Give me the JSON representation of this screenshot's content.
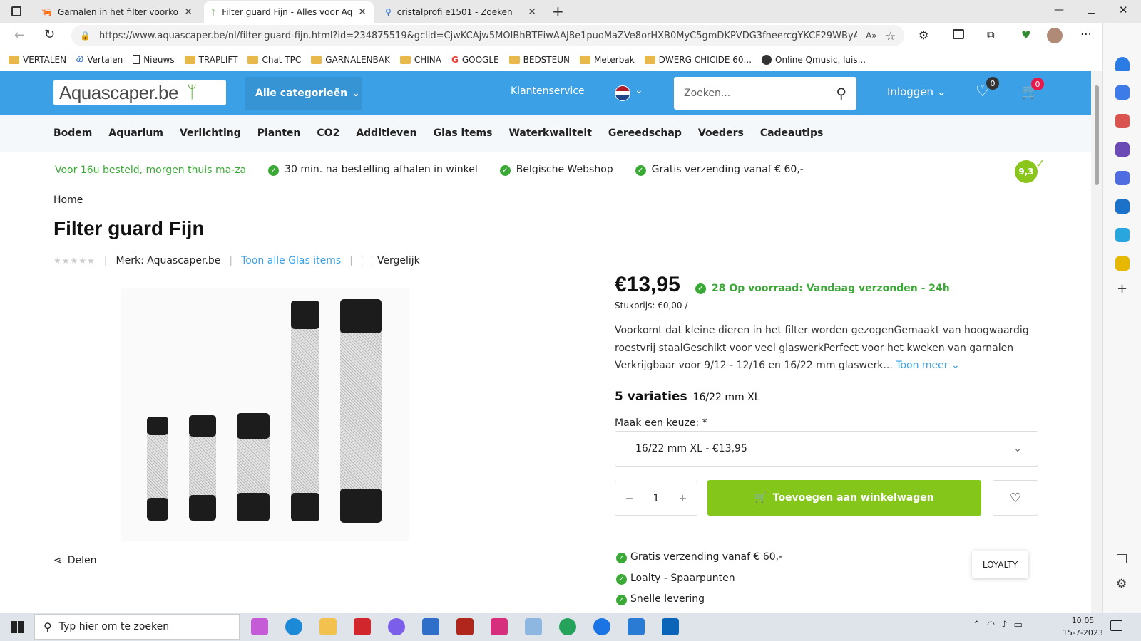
{
  "browser": {
    "tabs": [
      {
        "title": "Garnalen in het filter voorkomen",
        "active": false
      },
      {
        "title": "Filter guard Fijn - Alles voor Aqu",
        "active": true
      },
      {
        "title": "cristalprofi e1501 - Zoeken",
        "active": false
      }
    ],
    "url": "https://www.aquascaper.be/nl/filter-guard-fijn.html?id=234875519&gclid=CjwKCAjw5MOIBhBTEiwAAJ8e1puoMaZVe8orHXB0MyC5gmDKPVDG3fheercgYKCF29WByA...",
    "bookmarks": [
      "VERTALEN",
      "Vertalen",
      "Nieuws",
      "TRAPLIFT",
      "Chat TPC",
      "GARNALENBAK",
      "CHINA",
      "GOOGLE",
      "BEDSTEUN",
      "Meterbak",
      "DWERG CHICIDE 60...",
      "Online Qmusic, luis..."
    ]
  },
  "header": {
    "logo_text": "Aquascaper.be",
    "categories_label": "Alle categorieën",
    "service_label": "Klantenservice",
    "search_placeholder": "Zoeken...",
    "login_label": "Inloggen",
    "wishlist_count": "0",
    "cart_count": "0"
  },
  "catnav": [
    "Bodem",
    "Aquarium",
    "Verlichting",
    "Planten",
    "CO2",
    "Additieven",
    "Glas items",
    "Waterkwaliteit",
    "Gereedschap",
    "Voeders",
    "Cadeautips"
  ],
  "usps": {
    "delivery": "Voor 16u besteld, morgen thuis ma-za",
    "items": [
      "30 min. na bestelling afhalen in winkel",
      "Belgische Webshop",
      "Gratis verzending vanaf € 60,-"
    ],
    "score": "9,3"
  },
  "breadcrumb": "Home",
  "product": {
    "title": "Filter guard Fijn",
    "brand": "Merk: Aquascaper.be",
    "show_all": "Toon alle Glas items",
    "compare": "Vergelijk",
    "share": "Delen",
    "price": "€13,95",
    "stock": "28 Op voorraad: Vandaag verzonden - 24h",
    "unit_price": "Stukprijs: €0,00 /",
    "description": "Voorkomt dat kleine dieren in het filter worden gezogenGemaakt van hoogwaardig roestvrij staalGeschikt voor veel glaswerkPerfect voor het kweken van garnalen Verkrijgbaar voor 9/12 - 12/16 en 16/22 mm glaswerk...",
    "show_more": "Toon meer",
    "variants_title": "5 variaties",
    "variants_current": "16/22 mm XL",
    "choose_label": "Maak een keuze:  *",
    "selected_option": "16/22 mm XL - €13,95",
    "quantity": "1",
    "add_to_cart": "Toevoegen aan winkelwagen",
    "benefits": [
      "Gratis verzending vanaf € 60,-",
      "Loalty - Spaarpunten",
      "Snelle levering"
    ],
    "loyalty": "LOYALTY"
  },
  "taskbar": {
    "search_placeholder": "Typ hier om te zoeken",
    "time": "10:05",
    "date": "15-7-2023"
  }
}
